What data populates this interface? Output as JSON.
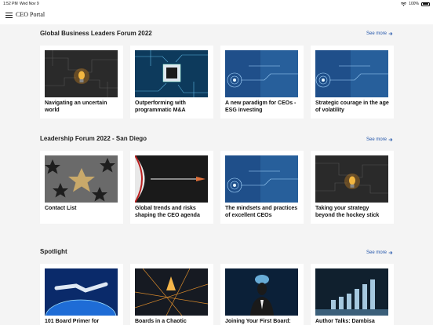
{
  "status": {
    "time": "1:52 PM",
    "date": "Wed Nov 9",
    "battery": "100%"
  },
  "header": {
    "title": "CEO Portal"
  },
  "sections": [
    {
      "title": "Global Business Leaders Forum 2022",
      "see_more": "See more",
      "cards": [
        {
          "title": "Navigating an uncertain world",
          "image": "lightbulb-circuit"
        },
        {
          "title": "Outperforming with programmatic M&A",
          "image": "chip-board"
        },
        {
          "title": "A new paradigm for CEOs - ESG investing",
          "image": "blue-tech"
        },
        {
          "title": "Strategic courage in the age of volatility",
          "image": "blue-tech"
        }
      ]
    },
    {
      "title": "Leadership Forum 2022 - San Diego",
      "see_more": "See more",
      "cards": [
        {
          "title": "Contact List",
          "image": "stars"
        },
        {
          "title": "Global trends and risks shaping the CEO agenda",
          "image": "dart"
        },
        {
          "title": "The mindsets and practices of excellent CEOs",
          "image": "blue-tech"
        },
        {
          "title": "Taking your strategy beyond the hockey stick",
          "image": "lightbulb-circuit"
        }
      ]
    },
    {
      "title": "Spotlight",
      "see_more": "See more",
      "cards": [
        {
          "title": "101 Board Primer for",
          "image": "handshake-globe"
        },
        {
          "title": "Boards in a Chaotic",
          "image": "city-night"
        },
        {
          "title": "Joining Your First Board:",
          "image": "head-brain"
        },
        {
          "title": "Author Talks: Dambisa",
          "image": "city-bars"
        }
      ]
    }
  ]
}
